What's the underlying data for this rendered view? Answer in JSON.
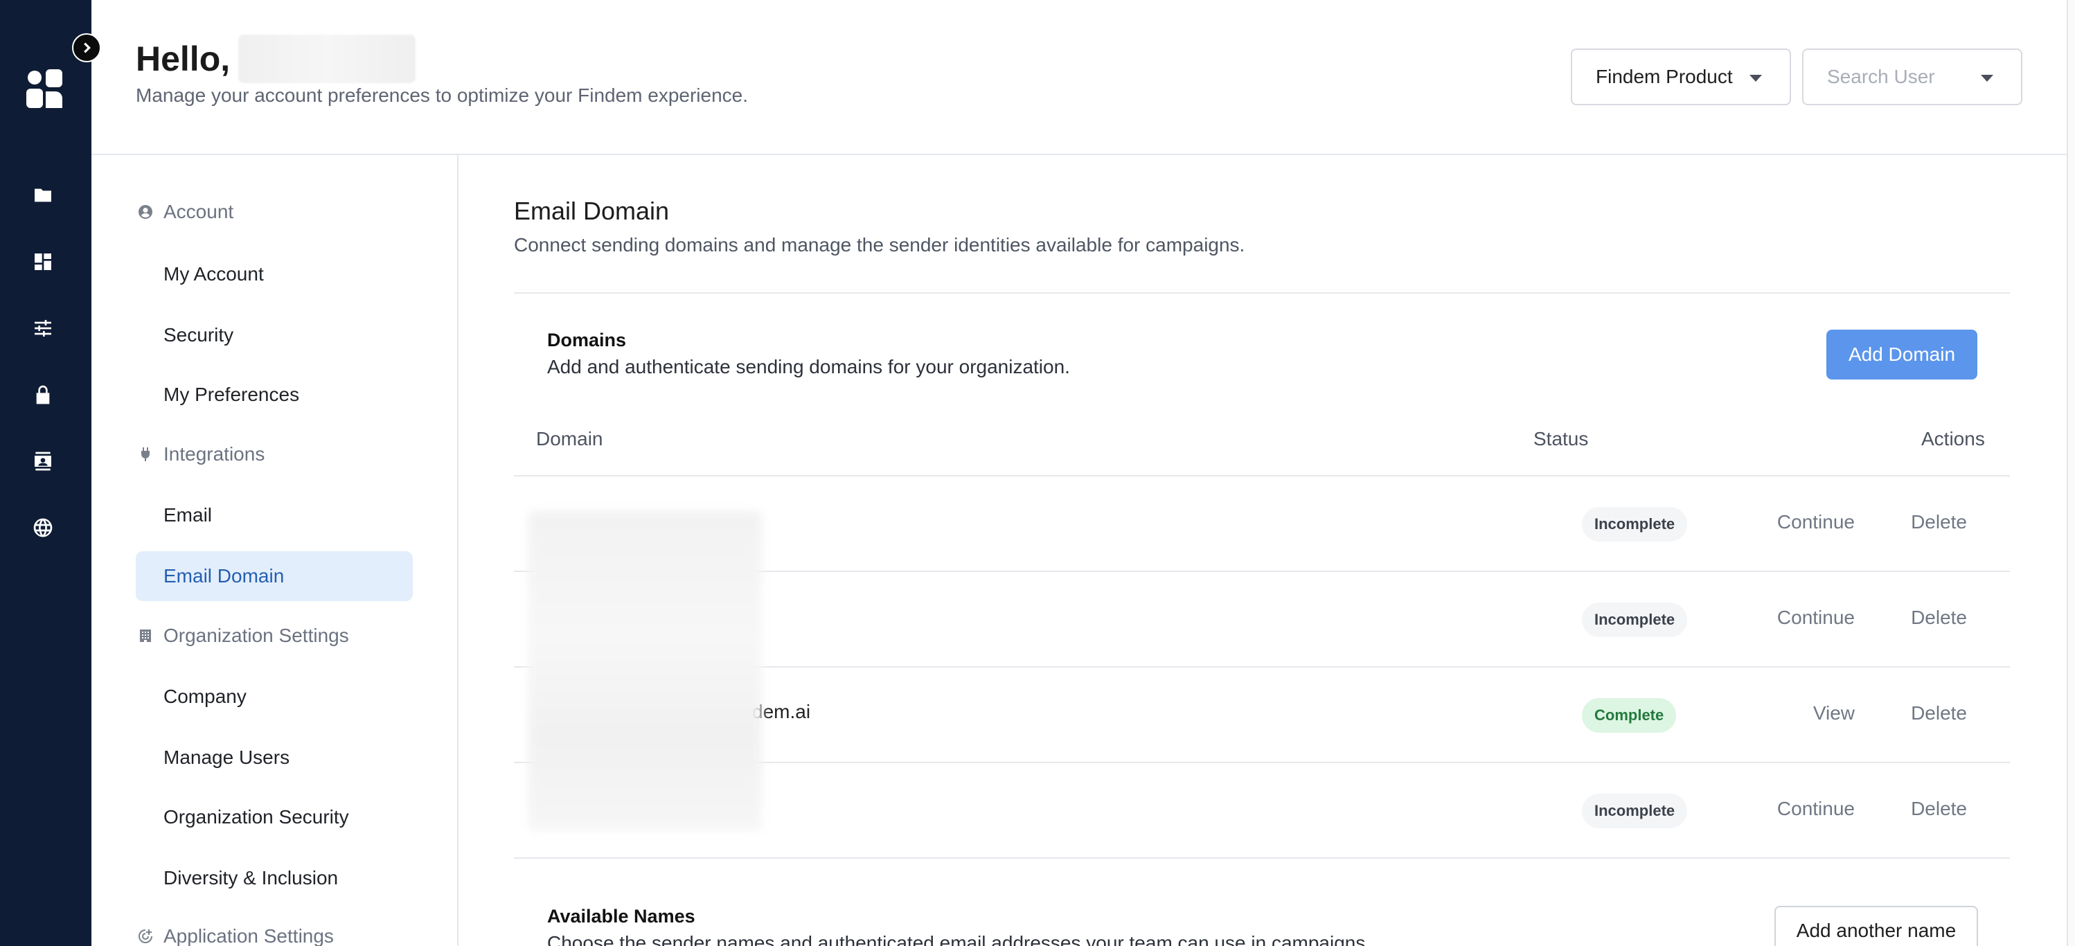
{
  "header": {
    "greeting": "Hello,",
    "subtitle": "Manage your account preferences to optimize your Findem experience.",
    "product_dropdown": "Findem Product",
    "user_search_placeholder": "Search User"
  },
  "nav": {
    "sections": [
      {
        "label": "Account",
        "icon": "user-circle-icon"
      },
      {
        "label": "Integrations",
        "icon": "plug-icon"
      },
      {
        "label": "Organization Settings",
        "icon": "building-icon"
      },
      {
        "label": "Application Settings",
        "icon": "app-settings-icon"
      }
    ],
    "items": {
      "my_account": "My Account",
      "security": "Security",
      "my_preferences": "My Preferences",
      "email": "Email",
      "email_domain": "Email Domain",
      "company": "Company",
      "manage_users": "Manage Users",
      "organization_security": "Organization Security",
      "diversity_inclusion": "Diversity & Inclusion"
    }
  },
  "rail": {
    "icons": [
      "folder-icon",
      "dashboard-icon",
      "sliders-icon",
      "lock-icon",
      "contact-card-icon",
      "globe-icon"
    ]
  },
  "main": {
    "title": "Email Domain",
    "description": "Connect sending domains and manage the sender identities available for campaigns.",
    "domains_card": {
      "title": "Domains",
      "description": "Add and authenticate sending domains for your organization.",
      "add_button": "Add Domain"
    },
    "table": {
      "columns": {
        "domain": "Domain",
        "status": "Status",
        "actions": "Actions"
      },
      "rows": [
        {
          "domain": "",
          "status": "Incomplete",
          "primary_action": "Continue",
          "delete": "Delete"
        },
        {
          "domain": "",
          "status": "Incomplete",
          "primary_action": "Continue",
          "delete": "Delete"
        },
        {
          "domain": "dem.ai",
          "status": "Complete",
          "primary_action": "View",
          "delete": "Delete"
        },
        {
          "domain": "",
          "status": "Incomplete",
          "primary_action": "Continue",
          "delete": "Delete"
        }
      ]
    },
    "names_card": {
      "title": "Available Names",
      "description": "Choose the sender names and authenticated email addresses your team can use in campaigns.",
      "add_button": "Add another name"
    }
  },
  "colors": {
    "rail": "#0f1c35",
    "primary": "#5b95ec",
    "active_nav_bg": "#e3eefc",
    "complete_bg": "#ddf5e3",
    "complete_text": "#247a3e"
  }
}
